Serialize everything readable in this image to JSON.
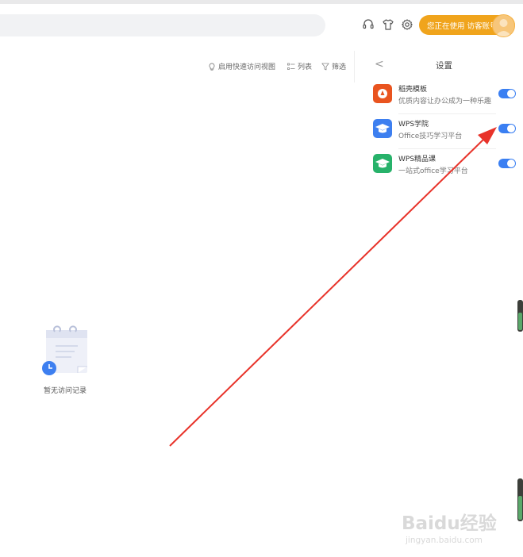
{
  "header": {
    "search_placeholder": "",
    "account_label": "您正在使用 访客账号"
  },
  "icons": {
    "headset": "headset-icon",
    "skin": "tshirt-icon",
    "settings": "gear-icon"
  },
  "viewbar": {
    "quick_access": "启用快速访问视图",
    "list": "列表",
    "filter": "筛选"
  },
  "settings_panel": {
    "back": "<",
    "title": "设置",
    "items": [
      {
        "name": "稻壳模板",
        "desc": "优质内容让办公成为一种乐趣",
        "enabled": true,
        "color": "#e9541f"
      },
      {
        "name": "WPS学院",
        "desc": "Office技巧学习平台",
        "enabled": true,
        "color": "#3d7ff0"
      },
      {
        "name": "WPS精品课",
        "desc": "一站式office学习平台",
        "enabled": true,
        "color": "#27b26a"
      }
    ]
  },
  "empty_state": {
    "text": "暂无访问记录"
  },
  "colors": {
    "accent": "#f0a41c",
    "toggle_on": "#3a7ff2",
    "arrow": "#e8332a"
  },
  "watermark": {
    "title": "Baidu经验",
    "url": "jingyan.baidu.com"
  }
}
